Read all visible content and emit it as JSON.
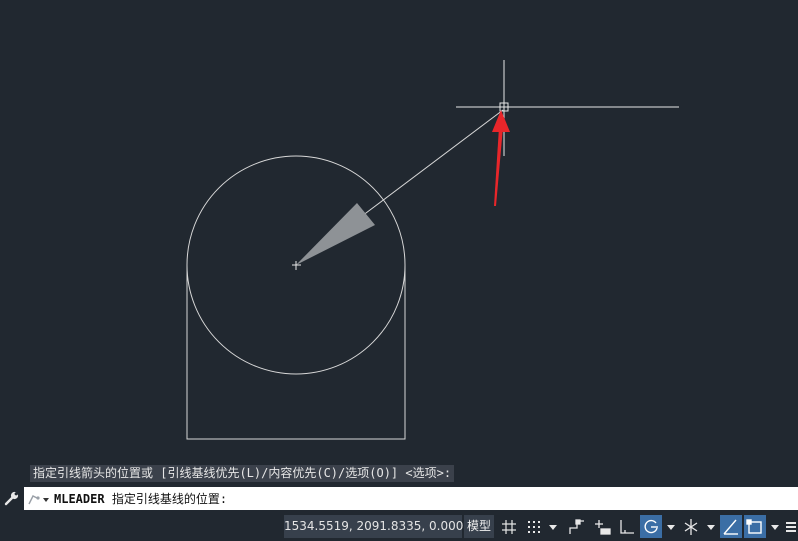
{
  "command": {
    "history_prompt": "指定引线箭头的位置或 [引线基线优先(L)/内容优先(C)/选项(O)] <选项>:",
    "name": "MLEADER",
    "current_prompt": "指定引线基线的位置:"
  },
  "status": {
    "coordinates": "1534.5519, 2091.8335, 0.0000",
    "space_label": "模型"
  },
  "colors": {
    "background": "#212830",
    "geometry": "#d8d8d8",
    "arrowhead": "#8e9296",
    "annotation_arrow": "#e8262a",
    "active_toggle": "#3b6ea5"
  },
  "icons": {
    "wrench": "wrench-icon",
    "grid": "grid-icon",
    "snap": "snap-icon",
    "infer": "infer-constraints-icon",
    "dynamic_input": "dynamic-input-icon",
    "ortho": "ortho-icon",
    "polar": "polar-tracking-icon",
    "isodraft": "isodraft-icon",
    "object_snap_tracking": "object-snap-tracking-icon",
    "object_snap": "object-snap-icon",
    "customize": "customize-icon"
  }
}
